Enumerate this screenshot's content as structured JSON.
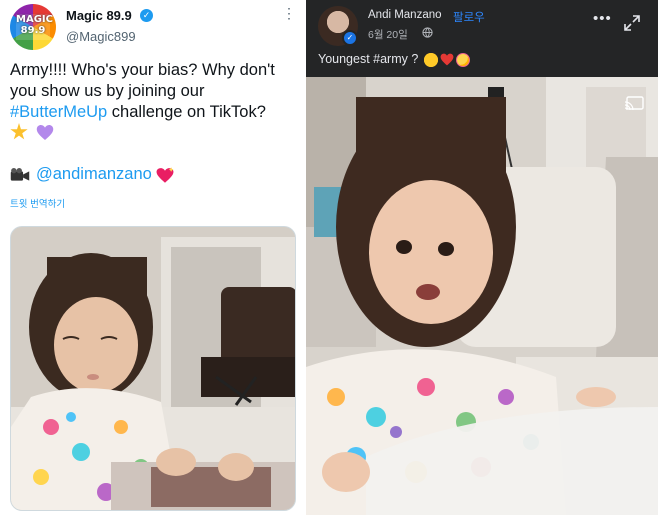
{
  "tweet": {
    "account_name": "Magic 89.9",
    "handle": "@Magic899",
    "avatar_text": "MAGIC 89.9",
    "text_line1": "Army!!!! Who's your bias? Why don't",
    "text_line2": "you show us by joining our",
    "hashtag": "#ButterMeUp",
    "text_line3_rest": " challenge on TikTok?",
    "mention": "@andimanzano",
    "translate_label": "트윗 번역하기",
    "icons": [
      "verified-badge-icon",
      "more-icon",
      "star-icon",
      "purple-heart-icon",
      "video-camera-icon",
      "sparkling-heart-icon"
    ]
  },
  "facebook": {
    "author_name": "Andi Manzano",
    "follow_label": "팔로우",
    "date": "6월 20일",
    "caption": "Youngest #army ?",
    "icons": [
      "verified-badge-icon",
      "globe-icon",
      "more-icon",
      "expand-icon",
      "star-struck-emoji-icon",
      "red-heart-icon",
      "smiling-face-with-hearts-icon",
      "cast-icon"
    ]
  },
  "colors": {
    "twitter_blue": "#1d9bf0",
    "facebook_dark": "#242526",
    "facebook_blue": "#2d88ff"
  }
}
